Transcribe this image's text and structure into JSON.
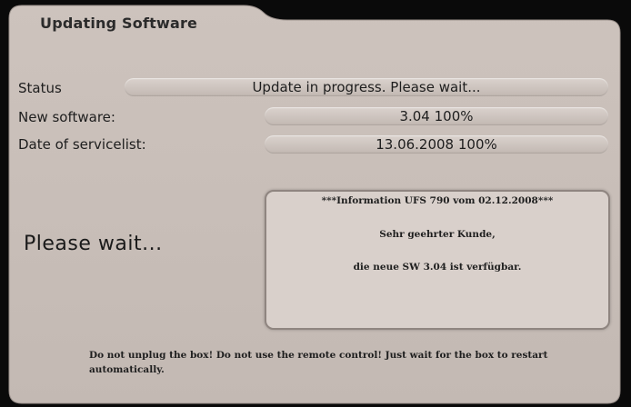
{
  "window": {
    "title": "Updating Software"
  },
  "status": {
    "label": "Status",
    "value": "Update in progress. Please wait..."
  },
  "new_software": {
    "label": "New software:",
    "version": "3.04",
    "percent": "100%",
    "progress": 1.0
  },
  "servicelist": {
    "label": "Date of servicelist:",
    "date": "13.06.2008",
    "percent": "100%",
    "progress": 1.0
  },
  "main": {
    "please_wait": "Please wait..."
  },
  "info": {
    "header": "***Information UFS 790 vom   02.12.2008***",
    "greeting": "Sehr geehrter Kunde,",
    "message": "die neue SW 3.04 ist verfügbar."
  },
  "footer": {
    "warning": "Do not unplug the box! Do not use the remote control! Just wait for the box to restart automatically."
  },
  "colors": {
    "panel": "#c9bfb9",
    "field": "#d2c9c4",
    "text": "#1e1e1e",
    "background": "#000000"
  }
}
